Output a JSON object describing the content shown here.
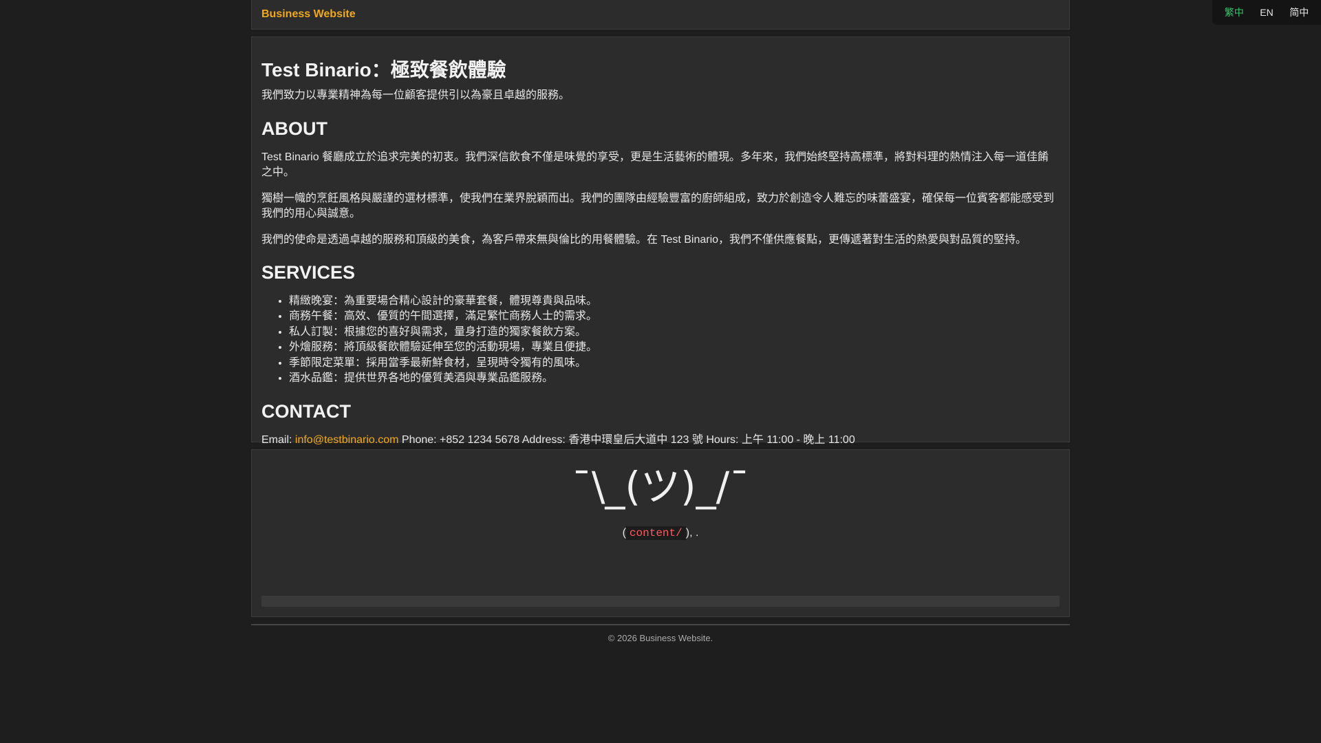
{
  "header": {
    "brand": "Business Website"
  },
  "languages": {
    "items": [
      "繁中",
      "EN",
      "简中"
    ],
    "active": "繁中",
    "active_color": "#35c46a"
  },
  "main": {
    "title": "Test Binario：極致餐飲體驗",
    "lede": "我們致力以專業精神為每一位顧客提供引以為豪且卓越的服務。",
    "about": {
      "heading": "ABOUT",
      "paragraphs": [
        "Test Binario 餐廳成立於追求完美的初衷。我們深信飲食不僅是味覺的享受，更是生活藝術的體現。多年來，我們始終堅持高標準，將對料理的熱情注入每一道佳餚之中。",
        "獨樹一幟的烹飪風格與嚴謹的選材標準，使我們在業界脫穎而出。我們的團隊由經驗豐富的廚師組成，致力於創造令人難忘的味蕾盛宴，確保每一位賓客都能感受到我們的用心與誠意。",
        "我們的使命是透過卓越的服務和頂級的美食，為客戶帶來無與倫比的用餐體驗。在 Test Binario，我們不僅供應餐點，更傳遞著對生活的熱愛與對品質的堅持。"
      ]
    },
    "services": {
      "heading": "SERVICES",
      "items": [
        "精緻晚宴：為重要場合精心設計的豪華套餐，體現尊貴與品味。",
        "商務午餐：高效、優質的午間選擇，滿足繁忙商務人士的需求。",
        "私人訂製：根據您的喜好與需求，量身打造的獨家餐飲方案。",
        "外燴服務：將頂級餐飲體驗延伸至您的活動現場，專業且便捷。",
        "季節限定菜單：採用當季最新鮮食材，呈現時令獨有的風味。",
        "酒水品鑑：提供世界各地的優質美酒與專業品鑑服務。"
      ]
    },
    "contact": {
      "heading": "CONTACT",
      "email_label": "Email:",
      "email": "info@testbinario.com",
      "rest": "Phone: +852 1234 5678 Address: 香港中環皇后大道中 123 號 Hours: 上午 11:00 - 晚上 11:00"
    }
  },
  "shrug_card": {
    "emoticon": "¯\\_(ツ)_/¯",
    "note_open": "(",
    "note_code": "content/",
    "note_close": "), ."
  },
  "footer": {
    "text": "© 2026 Business Website."
  },
  "colors": {
    "background": "#1e1e1e",
    "card": "#2c2c2c",
    "accent": "#f0a81c",
    "code": "#ff5a5f"
  }
}
